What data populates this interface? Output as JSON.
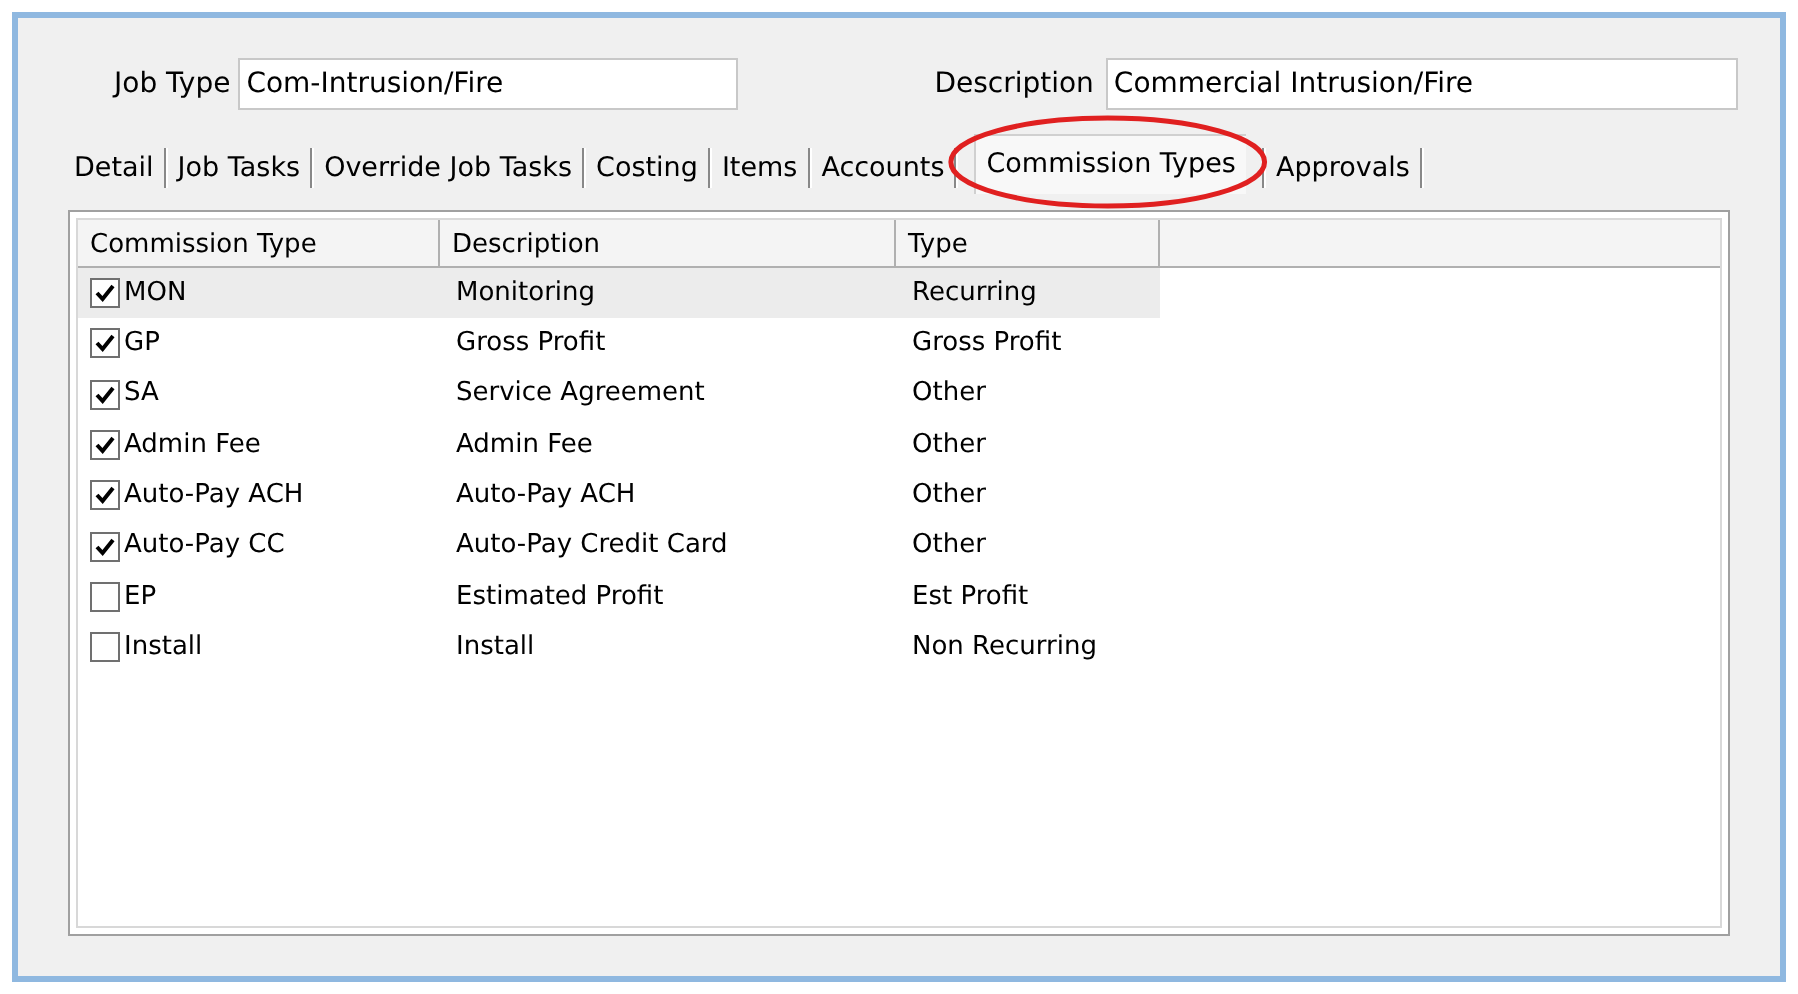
{
  "fields": [
    {
      "label": "Job Type",
      "value": "Com-Intrusion/Fire"
    },
    {
      "label": "Description",
      "value": "Commercial Intrusion/Fire"
    }
  ],
  "tabs": [
    {
      "label": "Detail",
      "selected": false
    },
    {
      "label": "Job Tasks",
      "selected": false
    },
    {
      "label": "Override Job Tasks",
      "selected": false
    },
    {
      "label": "Costing",
      "selected": false
    },
    {
      "label": "Items",
      "selected": false
    },
    {
      "label": "Accounts",
      "selected": false
    },
    {
      "label": "Commission Types",
      "selected": true,
      "circled": true
    },
    {
      "label": "Approvals",
      "selected": false
    }
  ],
  "table": {
    "columns": [
      "Commission Type",
      "Description",
      "Type"
    ],
    "rows": [
      {
        "checked": true,
        "selected": true,
        "cells": [
          "MON",
          "Monitoring",
          "Recurring"
        ]
      },
      {
        "checked": true,
        "selected": false,
        "cells": [
          "GP",
          "Gross Profit",
          "Gross Profit"
        ]
      },
      {
        "checked": true,
        "selected": false,
        "cells": [
          "SA",
          "Service Agreement",
          "Other"
        ]
      },
      {
        "checked": true,
        "selected": false,
        "cells": [
          "Admin Fee",
          "Admin Fee",
          "Other"
        ]
      },
      {
        "checked": true,
        "selected": false,
        "cells": [
          "Auto-Pay ACH",
          "Auto-Pay ACH",
          "Other"
        ]
      },
      {
        "checked": true,
        "selected": false,
        "cells": [
          "Auto-Pay CC",
          "Auto-Pay Credit Card",
          "Other"
        ]
      },
      {
        "checked": false,
        "selected": false,
        "cells": [
          "EP",
          "Estimated Profit",
          "Est Profit"
        ]
      },
      {
        "checked": false,
        "selected": false,
        "cells": [
          "Install",
          "Install",
          "Non Recurring"
        ]
      }
    ]
  }
}
